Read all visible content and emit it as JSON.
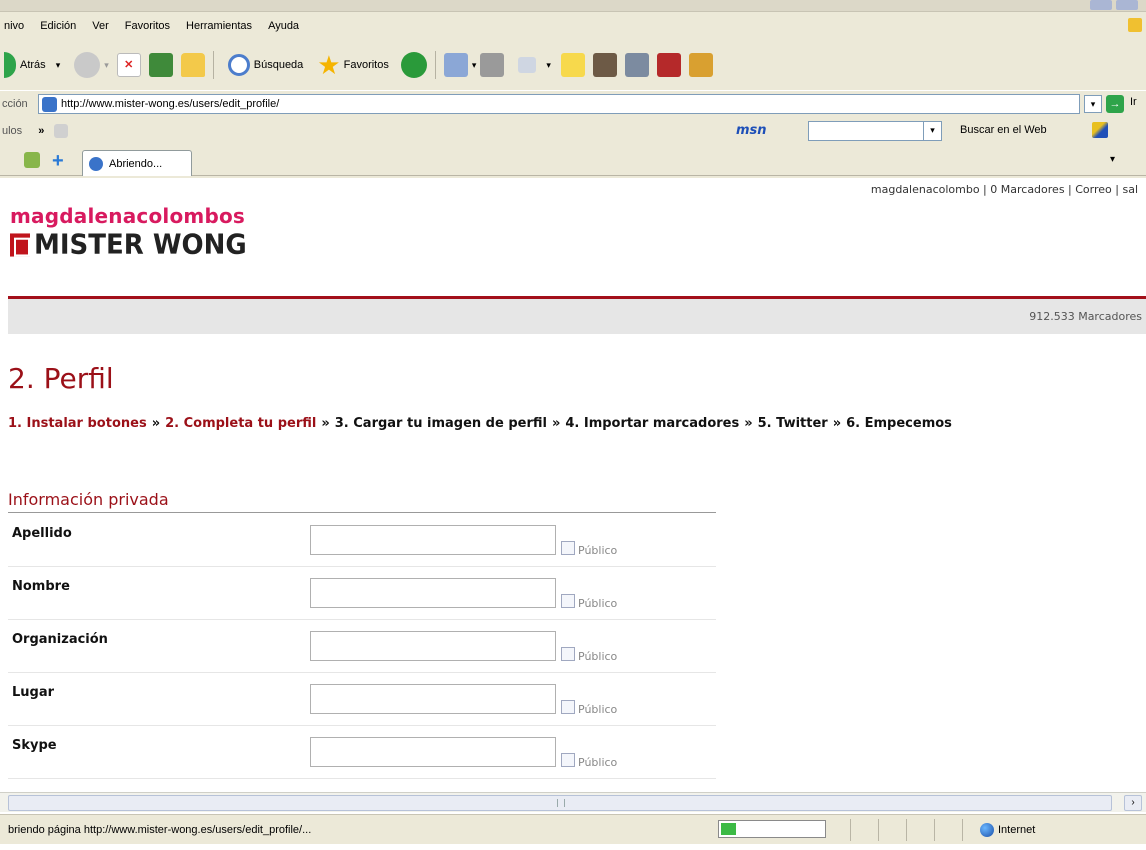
{
  "browser": {
    "menu": [
      "nivo",
      "Edición",
      "Ver",
      "Favoritos",
      "Herramientas",
      "Ayuda"
    ],
    "toolbar": {
      "back_label": "Atrás",
      "search_label": "Búsqueda",
      "favorites_label": "Favoritos"
    },
    "address": {
      "label": "cción",
      "url": "http://www.mister-wong.es/users/edit_profile/",
      "go_label": "Ir"
    },
    "links": {
      "label": "ulos",
      "msn_logo": "msn",
      "msn_search_label": "Buscar en el Web"
    },
    "tab": {
      "label": "Abriendo..."
    },
    "status": {
      "text": "briendo página http://www.mister-wong.es/users/edit_profile/...",
      "zone": "Internet",
      "progress": 0.15
    }
  },
  "page": {
    "userbar": "magdalenacolombo | 0 Marcadores | Correo | sal",
    "site_user": "magdalenacolombos",
    "site_brand": "MISTER WONG",
    "bookmark_count": "912.533 Marcadores",
    "title": "2. Perfil",
    "steps": [
      {
        "label": "1. Instalar botones",
        "active": true
      },
      {
        "label": "2. Completa tu perfil",
        "active": true
      },
      {
        "label": "3. Cargar tu imagen de perfil",
        "active": false
      },
      {
        "label": "4. Importar marcadores",
        "active": false
      },
      {
        "label": "5. Twitter",
        "active": false
      },
      {
        "label": "6. Empecemos",
        "active": false
      }
    ],
    "step_separator": "»",
    "section_title": "Información privada",
    "fields": [
      {
        "label": "Apellido",
        "value": "",
        "public_label": "Público",
        "public": false
      },
      {
        "label": "Nombre",
        "value": "",
        "public_label": "Público",
        "public": false
      },
      {
        "label": "Organización",
        "value": "",
        "public_label": "Público",
        "public": false
      },
      {
        "label": "Lugar",
        "value": "",
        "public_label": "Público",
        "public": false
      },
      {
        "label": "Skype",
        "value": "",
        "public_label": "Público",
        "public": false
      }
    ]
  },
  "colors": {
    "brand_red": "#9b1018",
    "user_pink": "#d81a5f",
    "chrome": "#ece9d8"
  }
}
